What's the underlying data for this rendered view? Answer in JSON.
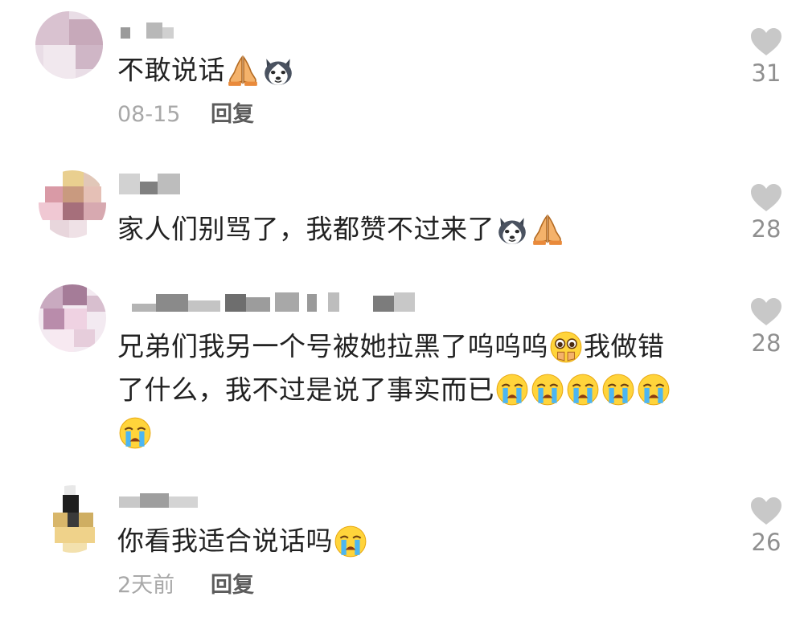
{
  "comments": [
    {
      "text_parts": [
        "不敢说话"
      ],
      "trailing_emojis": [
        "pray-emoji",
        "husky-emoji"
      ],
      "date": "08-15",
      "reply_label": "回复",
      "likes": "31"
    },
    {
      "text_parts": [
        "家人们别骂了，我都赞不过来了"
      ],
      "trailing_emojis": [
        "husky-emoji",
        "pray-emoji"
      ],
      "likes": "28"
    },
    {
      "line1": "兄弟们我另一个号被她拉黑了呜呜呜",
      "line1_after": "我做错",
      "line2": "了什么，我不过是说了事实而已",
      "likes": "28"
    },
    {
      "text_parts": [
        "你看我适合说话吗"
      ],
      "trailing_emojis": [
        "crying-emoji"
      ],
      "date": "2天前",
      "reply_label": "回复",
      "likes": "26"
    }
  ],
  "colors": {
    "text": "#222222",
    "meta": "#a8a8a8",
    "reply": "#5c5c5c",
    "like_icon": "#c8c8c8",
    "like_count": "#8f8f8f"
  }
}
